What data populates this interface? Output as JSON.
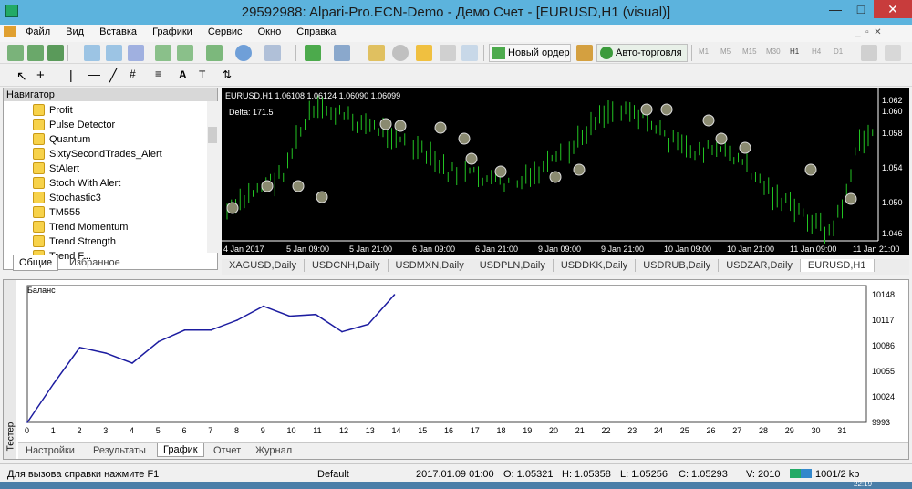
{
  "window": {
    "title": "29592988: Alpari-Pro.ECN-Demo - Демо Счет - [EURUSD,H1 (visual)]"
  },
  "menu": [
    "Файл",
    "Вид",
    "Вставка",
    "Графики",
    "Сервис",
    "Окно",
    "Справка"
  ],
  "toolbar": {
    "new_order": "Новый ордер",
    "autotrading": "Авто-торговля",
    "timeframes": [
      "M1",
      "M5",
      "M15",
      "M30",
      "H1",
      "H4",
      "D1"
    ]
  },
  "navigator": {
    "title": "Навигатор",
    "items": [
      "Profit",
      "Pulse Detector",
      "Quantum",
      "SixtySecondTrades_Alert",
      "StAlert",
      "Stoch With Alert",
      "Stochastic3",
      "TM555",
      "Trend Momentum",
      "Trend Strength",
      "Trend F..."
    ],
    "tabs": [
      "Общие",
      "Избранное"
    ]
  },
  "chart": {
    "header": "EURUSD,H1  1.06108 1.06124 1.06090 1.06099",
    "delta": "Delta: 171.5",
    "price_labels": [
      "1.062",
      "1.060",
      "1.058",
      "1.054",
      "1.050",
      "1.046"
    ],
    "time_labels": [
      "4 Jan 2017",
      "5 Jan 09:00",
      "5 Jan 21:00",
      "6 Jan 09:00",
      "6 Jan 21:00",
      "9 Jan 09:00",
      "9 Jan 21:00",
      "10 Jan 09:00",
      "10 Jan 21:00",
      "11 Jan 09:00",
      "11 Jan 21:00"
    ]
  },
  "symbol_tabs": [
    "XAGUSD,Daily",
    "USDCNH,Daily",
    "USDMXN,Daily",
    "USDPLN,Daily",
    "USDDKK,Daily",
    "USDRUB,Daily",
    "USDZAR,Daily",
    "EURUSD,H1"
  ],
  "tester": {
    "side_label": "Тестер",
    "graph_label": "Баланс",
    "y_labels": [
      "10148",
      "10117",
      "10086",
      "10055",
      "10024",
      "9993"
    ],
    "tabs": [
      "Настройки",
      "Результаты",
      "График",
      "Отчет",
      "Журнал"
    ]
  },
  "chart_data": {
    "type": "line",
    "title": "Баланс",
    "x": [
      0,
      1,
      2,
      3,
      4,
      5,
      6,
      7,
      8,
      9,
      10,
      11,
      12,
      13,
      14
    ],
    "x_ticks": [
      0,
      1,
      2,
      3,
      4,
      5,
      6,
      7,
      8,
      9,
      10,
      11,
      12,
      13,
      14,
      15,
      16,
      17,
      18,
      19,
      20,
      21,
      22,
      23,
      24,
      25,
      26,
      27,
      28,
      29,
      30,
      31
    ],
    "series": [
      {
        "values": [
          9993,
          10040,
          10084,
          10077,
          10065,
          10091,
          10105,
          10105,
          10117,
          10134,
          10122,
          10124,
          10103,
          10112,
          10148
        ]
      }
    ],
    "ylim": [
      9993,
      10148
    ],
    "xlim": [
      0,
      32
    ],
    "color": "#1c1ca0"
  },
  "status": {
    "help": "Для вызова справки нажмите F1",
    "profile": "Default",
    "time": "2017.01.09 01:00",
    "open": "O: 1.05321",
    "high": "H: 1.05358",
    "low": "L: 1.05256",
    "close": "C: 1.05293",
    "volume": "V: 2010",
    "traffic": "1001/2 kb",
    "clock": "22:19"
  },
  "colors": {
    "titlebar": "#5cb3dd",
    "candle": "#22c422",
    "balance_line": "#1c1ca0"
  }
}
